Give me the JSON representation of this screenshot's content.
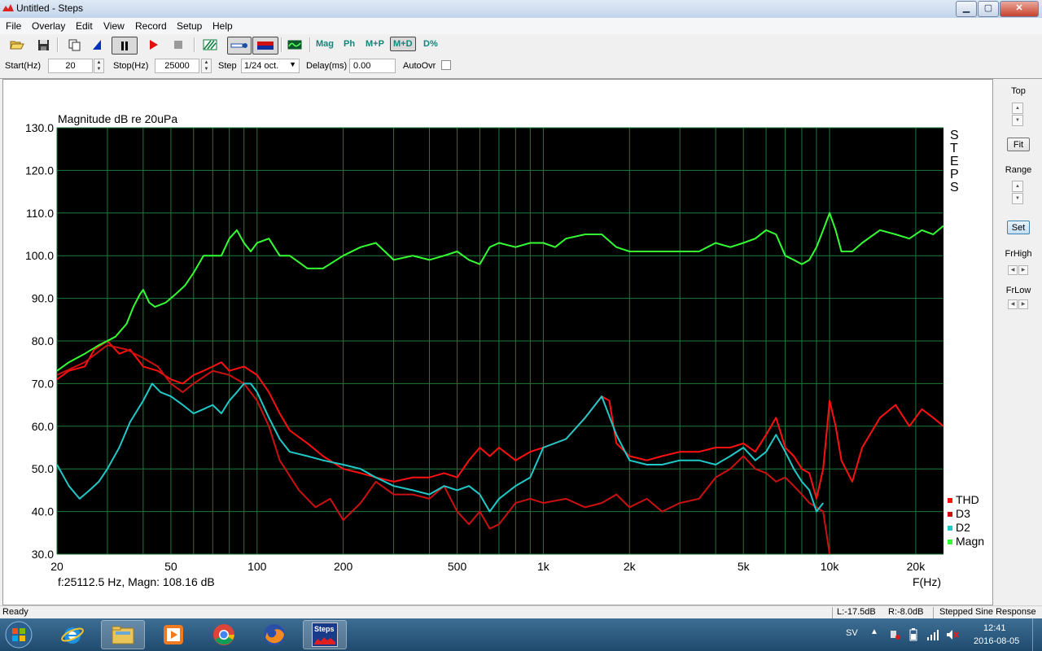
{
  "window": {
    "title": "Untitled - Steps",
    "min": "▁",
    "max": "▢",
    "close": "✕"
  },
  "menu": [
    "File",
    "Overlay",
    "Edit",
    "View",
    "Record",
    "Setup",
    "Help"
  ],
  "toolbar": {
    "mag": "Mag",
    "ph": "Ph",
    "mp": "M+P",
    "md": "M+D",
    "dpct": "D%"
  },
  "params": {
    "start_label": "Start(Hz)",
    "start_value": "20",
    "stop_label": "Stop(Hz)",
    "stop_value": "25000",
    "step_label": "Step",
    "step_value": "1/24 oct.",
    "delay_label": "Delay(ms)",
    "delay_value": "0.00",
    "autoovr_label": "AutoOvr"
  },
  "right_panel": {
    "top": "Top",
    "fit": "Fit",
    "range": "Range",
    "set": "Set",
    "frhigh": "FrHigh",
    "frlow": "FrLow"
  },
  "status": {
    "ready": "Ready",
    "left": "L:-17.5dB",
    "right": "R:-8.0dB",
    "mode": "Stepped Sine Response"
  },
  "taskbar": {
    "lang": "SV",
    "time": "12:41",
    "date": "2016-08-05",
    "steps_label": "Steps"
  },
  "chart_data": {
    "type": "line",
    "title": "Magnitude dB re 20uPa",
    "xlabel": "F(Hz)",
    "ylabel": "",
    "x_scale": "log",
    "xlim": [
      20,
      25000
    ],
    "ylim": [
      30,
      130
    ],
    "grid": true,
    "background": "#000000",
    "brand": "STEPS",
    "cursor_readout": "f:25112.5 Hz, Magn: 108.16 dB",
    "y_ticks": [
      {
        "v": 30,
        "label": "30.0"
      },
      {
        "v": 40,
        "label": "40.0"
      },
      {
        "v": 50,
        "label": "50.0"
      },
      {
        "v": 60,
        "label": "60.0"
      },
      {
        "v": 70,
        "label": "70.0"
      },
      {
        "v": 80,
        "label": "80.0"
      },
      {
        "v": 90,
        "label": "90.0"
      },
      {
        "v": 100,
        "label": "100.0"
      },
      {
        "v": 110,
        "label": "110.0"
      },
      {
        "v": 120,
        "label": "120.0"
      },
      {
        "v": 130,
        "label": "130.0"
      }
    ],
    "x_ticks": [
      {
        "v": 20,
        "label": "20"
      },
      {
        "v": 50,
        "label": "50"
      },
      {
        "v": 100,
        "label": "100"
      },
      {
        "v": 200,
        "label": "200"
      },
      {
        "v": 500,
        "label": "500"
      },
      {
        "v": 1000,
        "label": "1k"
      },
      {
        "v": 2000,
        "label": "2k"
      },
      {
        "v": 5000,
        "label": "5k"
      },
      {
        "v": 10000,
        "label": "10k"
      },
      {
        "v": 20000,
        "label": "20k"
      }
    ],
    "legend": {
      "position": "bottom-right"
    },
    "series": [
      {
        "name": "THD",
        "color": "#ff1010",
        "points": [
          [
            20,
            71
          ],
          [
            22,
            73
          ],
          [
            25,
            74
          ],
          [
            27,
            78
          ],
          [
            30,
            80
          ],
          [
            33,
            77
          ],
          [
            36,
            78
          ],
          [
            40,
            74
          ],
          [
            45,
            73
          ],
          [
            50,
            71
          ],
          [
            55,
            70
          ],
          [
            60,
            72
          ],
          [
            65,
            73
          ],
          [
            70,
            74
          ],
          [
            75,
            75
          ],
          [
            80,
            73
          ],
          [
            90,
            74
          ],
          [
            100,
            72
          ],
          [
            110,
            68
          ],
          [
            120,
            63
          ],
          [
            130,
            59
          ],
          [
            150,
            56
          ],
          [
            170,
            53
          ],
          [
            200,
            50
          ],
          [
            230,
            49
          ],
          [
            260,
            48
          ],
          [
            300,
            47
          ],
          [
            350,
            48
          ],
          [
            400,
            48
          ],
          [
            450,
            49
          ],
          [
            500,
            48
          ],
          [
            550,
            52
          ],
          [
            600,
            55
          ],
          [
            650,
            53
          ],
          [
            700,
            55
          ],
          [
            800,
            52
          ],
          [
            900,
            54
          ],
          [
            1000,
            55
          ],
          [
            1200,
            57
          ],
          [
            1400,
            62
          ],
          [
            1600,
            67
          ],
          [
            1700,
            66
          ],
          [
            1800,
            56
          ],
          [
            2000,
            53
          ],
          [
            2300,
            52
          ],
          [
            2600,
            53
          ],
          [
            3000,
            54
          ],
          [
            3500,
            54
          ],
          [
            4000,
            55
          ],
          [
            4500,
            55
          ],
          [
            5000,
            56
          ],
          [
            5500,
            54
          ],
          [
            6000,
            58
          ],
          [
            6500,
            62
          ],
          [
            7000,
            55
          ],
          [
            7500,
            53
          ],
          [
            8000,
            50
          ],
          [
            8500,
            49
          ],
          [
            9000,
            43
          ],
          [
            9500,
            50
          ],
          [
            10000,
            66
          ],
          [
            10500,
            60
          ],
          [
            11000,
            52
          ],
          [
            12000,
            47
          ],
          [
            13000,
            55
          ],
          [
            15000,
            62
          ],
          [
            17000,
            65
          ],
          [
            19000,
            60
          ],
          [
            21000,
            64
          ],
          [
            23000,
            62
          ],
          [
            25000,
            60
          ]
        ]
      },
      {
        "name": "D3",
        "color": "#cc1010",
        "points": [
          [
            20,
            72
          ],
          [
            25,
            75
          ],
          [
            30,
            79
          ],
          [
            35,
            78
          ],
          [
            40,
            76
          ],
          [
            45,
            74
          ],
          [
            50,
            70
          ],
          [
            55,
            68
          ],
          [
            60,
            70
          ],
          [
            70,
            73
          ],
          [
            80,
            72
          ],
          [
            90,
            70
          ],
          [
            100,
            66
          ],
          [
            110,
            60
          ],
          [
            120,
            52
          ],
          [
            140,
            45
          ],
          [
            160,
            41
          ],
          [
            180,
            43
          ],
          [
            200,
            38
          ],
          [
            230,
            42
          ],
          [
            260,
            47
          ],
          [
            300,
            44
          ],
          [
            350,
            44
          ],
          [
            400,
            43
          ],
          [
            450,
            46
          ],
          [
            500,
            40
          ],
          [
            550,
            37
          ],
          [
            600,
            40
          ],
          [
            650,
            36
          ],
          [
            700,
            37
          ],
          [
            800,
            42
          ],
          [
            900,
            43
          ],
          [
            1000,
            42
          ],
          [
            1200,
            43
          ],
          [
            1400,
            41
          ],
          [
            1600,
            42
          ],
          [
            1800,
            44
          ],
          [
            2000,
            41
          ],
          [
            2300,
            43
          ],
          [
            2600,
            40
          ],
          [
            3000,
            42
          ],
          [
            3500,
            43
          ],
          [
            4000,
            48
          ],
          [
            4500,
            50
          ],
          [
            5000,
            53
          ],
          [
            5500,
            50
          ],
          [
            6000,
            49
          ],
          [
            6500,
            47
          ],
          [
            7000,
            48
          ],
          [
            7500,
            46
          ],
          [
            8000,
            44
          ],
          [
            8500,
            42
          ],
          [
            9000,
            41
          ],
          [
            9500,
            40
          ],
          [
            10000,
            30
          ]
        ]
      },
      {
        "name": "D2",
        "color": "#20c8c8",
        "points": [
          [
            20,
            51
          ],
          [
            22,
            46
          ],
          [
            24,
            43
          ],
          [
            26,
            45
          ],
          [
            28,
            47
          ],
          [
            30,
            50
          ],
          [
            33,
            55
          ],
          [
            36,
            61
          ],
          [
            40,
            66
          ],
          [
            43,
            70
          ],
          [
            46,
            68
          ],
          [
            50,
            67
          ],
          [
            55,
            65
          ],
          [
            60,
            63
          ],
          [
            65,
            64
          ],
          [
            70,
            65
          ],
          [
            75,
            63
          ],
          [
            80,
            66
          ],
          [
            85,
            68
          ],
          [
            90,
            70
          ],
          [
            95,
            70
          ],
          [
            100,
            68
          ],
          [
            110,
            62
          ],
          [
            120,
            57
          ],
          [
            130,
            54
          ],
          [
            150,
            53
          ],
          [
            170,
            52
          ],
          [
            200,
            51
          ],
          [
            230,
            50
          ],
          [
            260,
            48
          ],
          [
            300,
            46
          ],
          [
            350,
            45
          ],
          [
            400,
            44
          ],
          [
            450,
            46
          ],
          [
            500,
            45
          ],
          [
            550,
            46
          ],
          [
            600,
            44
          ],
          [
            650,
            40
          ],
          [
            700,
            43
          ],
          [
            800,
            46
          ],
          [
            900,
            48
          ],
          [
            1000,
            55
          ],
          [
            1200,
            57
          ],
          [
            1400,
            62
          ],
          [
            1600,
            67
          ],
          [
            1800,
            58
          ],
          [
            2000,
            52
          ],
          [
            2300,
            51
          ],
          [
            2600,
            51
          ],
          [
            3000,
            52
          ],
          [
            3500,
            52
          ],
          [
            4000,
            51
          ],
          [
            4500,
            53
          ],
          [
            5000,
            55
          ],
          [
            5500,
            52
          ],
          [
            6000,
            54
          ],
          [
            6500,
            58
          ],
          [
            7000,
            54
          ],
          [
            7500,
            50
          ],
          [
            8000,
            47
          ],
          [
            8500,
            45
          ],
          [
            9000,
            40
          ],
          [
            9500,
            42
          ]
        ]
      },
      {
        "name": "Magn",
        "color": "#33ff33",
        "points": [
          [
            20,
            73
          ],
          [
            22,
            75
          ],
          [
            25,
            77
          ],
          [
            28,
            79
          ],
          [
            32,
            81
          ],
          [
            35,
            84
          ],
          [
            37,
            88
          ],
          [
            39,
            91
          ],
          [
            40,
            92
          ],
          [
            42,
            89
          ],
          [
            44,
            88
          ],
          [
            48,
            89
          ],
          [
            52,
            91
          ],
          [
            56,
            93
          ],
          [
            60,
            96
          ],
          [
            65,
            100
          ],
          [
            70,
            100
          ],
          [
            75,
            100
          ],
          [
            80,
            104
          ],
          [
            85,
            106
          ],
          [
            90,
            103
          ],
          [
            95,
            101
          ],
          [
            100,
            103
          ],
          [
            110,
            104
          ],
          [
            120,
            100
          ],
          [
            130,
            100
          ],
          [
            150,
            97
          ],
          [
            170,
            97
          ],
          [
            200,
            100
          ],
          [
            230,
            102
          ],
          [
            260,
            103
          ],
          [
            300,
            99
          ],
          [
            350,
            100
          ],
          [
            400,
            99
          ],
          [
            450,
            100
          ],
          [
            500,
            101
          ],
          [
            550,
            99
          ],
          [
            600,
            98
          ],
          [
            650,
            102
          ],
          [
            700,
            103
          ],
          [
            800,
            102
          ],
          [
            900,
            103
          ],
          [
            1000,
            103
          ],
          [
            1100,
            102
          ],
          [
            1200,
            104
          ],
          [
            1400,
            105
          ],
          [
            1600,
            105
          ],
          [
            1800,
            102
          ],
          [
            2000,
            101
          ],
          [
            2300,
            101
          ],
          [
            2600,
            101
          ],
          [
            3000,
            101
          ],
          [
            3500,
            101
          ],
          [
            4000,
            103
          ],
          [
            4500,
            102
          ],
          [
            5000,
            103
          ],
          [
            5500,
            104
          ],
          [
            6000,
            106
          ],
          [
            6500,
            105
          ],
          [
            7000,
            100
          ],
          [
            7500,
            99
          ],
          [
            8000,
            98
          ],
          [
            8500,
            99
          ],
          [
            9000,
            102
          ],
          [
            9500,
            106
          ],
          [
            10000,
            110
          ],
          [
            10500,
            106
          ],
          [
            11000,
            101
          ],
          [
            12000,
            101
          ],
          [
            13000,
            103
          ],
          [
            15000,
            106
          ],
          [
            17000,
            105
          ],
          [
            19000,
            104
          ],
          [
            21000,
            106
          ],
          [
            23000,
            105
          ],
          [
            25000,
            107
          ]
        ]
      }
    ]
  }
}
